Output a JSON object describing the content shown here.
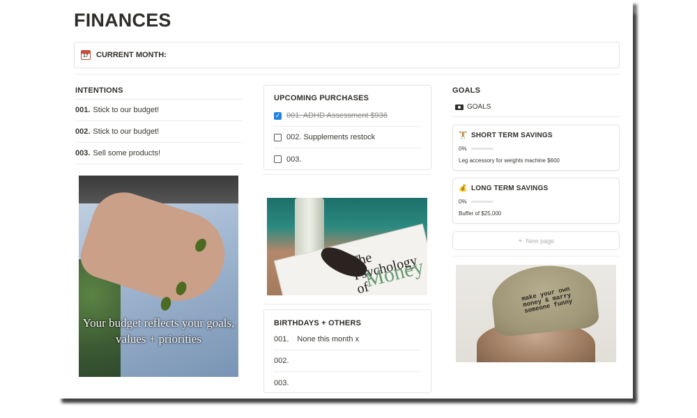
{
  "page": {
    "title": "FINANCES"
  },
  "callout": {
    "icon": "calendar-icon",
    "calendar_day": "17",
    "label": "CURRENT MONTH:"
  },
  "intentions": {
    "heading": "INTENTIONS",
    "items": [
      {
        "num": "001.",
        "text": "Stick to our budget!"
      },
      {
        "num": "002.",
        "text": "Stick to our budget!"
      },
      {
        "num": "003.",
        "text": "Sell some products!"
      }
    ],
    "photo_quote": "Your budget reflects your goals, values + priorities"
  },
  "purchases": {
    "heading": "UPCOMING PURCHASES",
    "items": [
      {
        "text": "001.  ADHD Assessment $936",
        "checked": true
      },
      {
        "text": "002. Supplements restock",
        "checked": false
      },
      {
        "text": "003.",
        "checked": false
      }
    ],
    "book_title": "The Psychology of",
    "book_money": "Money"
  },
  "birthdays": {
    "heading": "BIRTHDAYS + OTHERS",
    "items": [
      {
        "num": "001.",
        "text": "None this month x"
      },
      {
        "num": "002.",
        "text": ""
      },
      {
        "num": "003.",
        "text": ""
      }
    ]
  },
  "goals": {
    "heading": "GOALS",
    "link_label": "GOALS",
    "cards": [
      {
        "emoji": "🏋",
        "title": "SHORT TERM SAVINGS",
        "progress_label": "0%",
        "progress": 0,
        "desc": "Leg accessory for weights machine $600"
      },
      {
        "emoji": "💰",
        "title": "LONG TERM SAVINGS",
        "progress_label": "0%",
        "progress": 0,
        "desc": "Buffer of $25,000"
      }
    ],
    "new_page": "New page",
    "cap_text": "make your own money & marry someone funny"
  },
  "colors": {
    "accent": "#2383e2",
    "text": "#37352f",
    "border": "#e4e4e2"
  }
}
